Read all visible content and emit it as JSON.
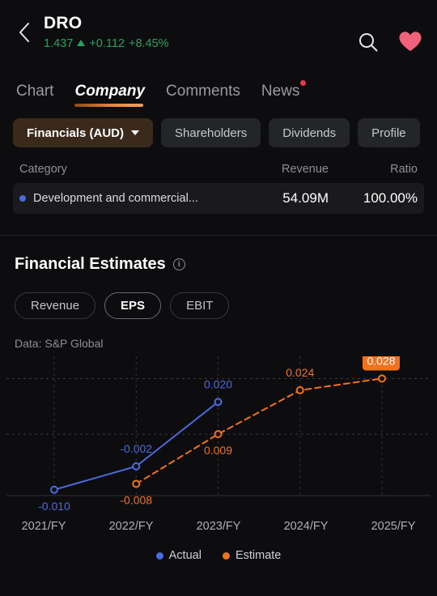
{
  "header": {
    "back_icon": "chevron-left-icon",
    "symbol": "DRO",
    "price": "1.437",
    "change_abs": "+0.112",
    "change_pct": "+8.45%",
    "direction": "up",
    "search_icon": "search-icon",
    "favorite_icon": "heart-icon",
    "positive_color": "#29a05e",
    "favorite_color": "#f2617a"
  },
  "tabs": [
    {
      "label": "Chart",
      "active": false,
      "badge": false
    },
    {
      "label": "Company",
      "active": true,
      "badge": false
    },
    {
      "label": "Comments",
      "active": false,
      "badge": false
    },
    {
      "label": "News",
      "active": false,
      "badge": true
    }
  ],
  "chips": [
    {
      "label": "Financials (AUD)",
      "active": true,
      "caret": true
    },
    {
      "label": "Shareholders",
      "active": false,
      "caret": false
    },
    {
      "label": "Dividends",
      "active": false,
      "caret": false
    },
    {
      "label": "Profile",
      "active": false,
      "caret": false
    }
  ],
  "revenue_table": {
    "columns": [
      "Category",
      "Revenue",
      "Ratio"
    ],
    "rows": [
      {
        "category": "Development and commercial...",
        "revenue": "54.09M",
        "ratio": "100.00%",
        "dot_color": "#4a6bdd"
      }
    ]
  },
  "financial_estimates": {
    "title": "Financial Estimates",
    "info_icon": "info-icon",
    "info_glyph": "i",
    "metrics": [
      {
        "label": "Revenue",
        "active": false
      },
      {
        "label": "EPS",
        "active": true
      },
      {
        "label": "EBIT",
        "active": false
      }
    ],
    "data_source": "Data: S&P Global",
    "legend": [
      {
        "label": "Actual",
        "color": "#4a6bdd"
      },
      {
        "label": "Estimate",
        "color": "#f2711c"
      }
    ]
  },
  "chart_data": {
    "type": "line",
    "title": "Financial Estimates — EPS",
    "xlabel": "",
    "ylabel": "EPS",
    "categories": [
      "2021/FY",
      "2022/FY",
      "2023/FY",
      "2024/FY",
      "2025/FY"
    ],
    "grid": true,
    "legend_position": "bottom",
    "ylim": [
      -0.012,
      0.032
    ],
    "highlight": {
      "label": "0.028",
      "series": "Estimate",
      "category": "2025/FY"
    },
    "series": [
      {
        "name": "Actual",
        "color": "#4a6bdd",
        "style": "solid",
        "points": [
          {
            "x": "2021/FY",
            "y": -0.01,
            "label": "-0.010"
          },
          {
            "x": "2022/FY",
            "y": -0.002,
            "label": "-0.002"
          },
          {
            "x": "2023/FY",
            "y": 0.02,
            "label": "0.020"
          }
        ]
      },
      {
        "name": "Estimate",
        "color": "#f2711c",
        "style": "dashed",
        "points": [
          {
            "x": "2022/FY",
            "y": -0.008,
            "label": "-0.008"
          },
          {
            "x": "2023/FY",
            "y": 0.009,
            "label": "0.009"
          },
          {
            "x": "2024/FY",
            "y": 0.024,
            "label": "0.024"
          },
          {
            "x": "2025/FY",
            "y": 0.028,
            "label": "0.028"
          }
        ]
      }
    ]
  }
}
